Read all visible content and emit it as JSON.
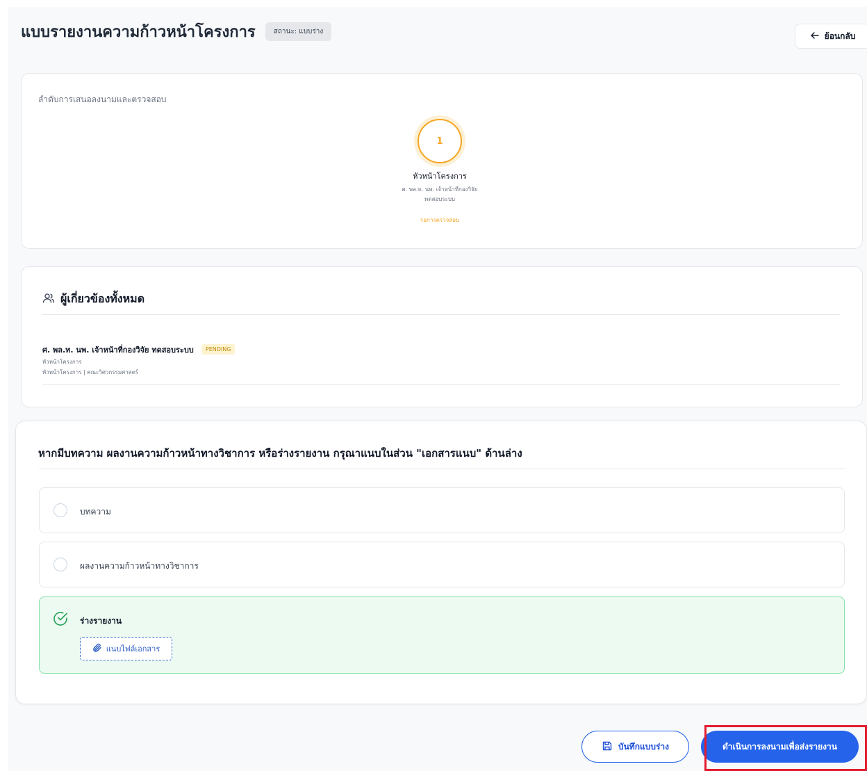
{
  "header": {
    "title": "แบบรายงานความก้าวหน้าโครงการ",
    "status": "สถานะ: แบบร่าง",
    "back_label": "ย้อนกลับ"
  },
  "approval": {
    "section_label": "ลำดับการเสนอลงนามและตรวจสอบ",
    "steps": [
      {
        "number": "1",
        "title": "หัวหน้าโครงการ",
        "name": "ศ. พล.ท. นพ. เจ้าหน้าที่กองวิจัย",
        "subname": "ทดสอบระบบ",
        "status": "รอการตรวจสอบ"
      }
    ]
  },
  "stakeholders": {
    "title": "ผู้เกี่ยวข้องทั้งหมด",
    "people": [
      {
        "name": "ศ. พล.ท. นพ. เจ้าหน้าที่กองวิจัย ทดสอบระบบ",
        "badge": "PENDING",
        "role": "หัวหน้าโครงการ",
        "department": "หัวหน้าโครงการ | คณะวิศวกรรมศาสตร์"
      }
    ]
  },
  "attachments": {
    "question": "หากมีบทความ ผลงานความก้าวหน้าทางวิชาการ หรือร่างรายงาน กรุณาแนบในส่วน \"เอกสารแนบ\" ด้านล่าง",
    "options": [
      {
        "label": "บทความ",
        "selected": false
      },
      {
        "label": "ผลงานความก้าวหน้าทางวิชาการ",
        "selected": false
      },
      {
        "label": "ร่างรายงาน",
        "selected": true
      }
    ],
    "attach_label": "แนบไฟล์เอกสาร"
  },
  "footer": {
    "save_label": "บันทึกแบบร่าง",
    "submit_label": "ดำเนินการลงนามเพื่อส่งรายงาน"
  },
  "colors": {
    "primary": "#2563eb",
    "pending": "#f5a623",
    "success_bg": "#ecfaf1",
    "highlight": "#e11d2e"
  }
}
